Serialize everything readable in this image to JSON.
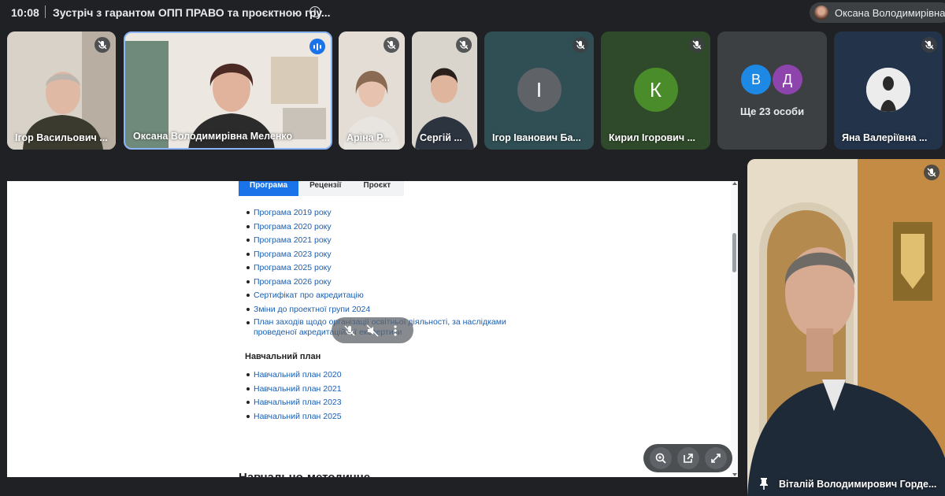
{
  "header": {
    "time": "10:08",
    "title": "Зустріч з гарантом ОПП ПРАВО та проєктною гру...",
    "info_icon": "info-icon",
    "presenter_name": "Оксана Володимирівна Ме"
  },
  "participants": [
    {
      "name": "Ігор Васильович ...",
      "status": "mic-off"
    },
    {
      "name": "Оксана Володимирівна Меленко",
      "status": "speaking"
    },
    {
      "name": "Аріна Р...",
      "status": "mic-off"
    },
    {
      "name": "Сергій ...",
      "status": "mic-off"
    },
    {
      "name": "Ігор Іванович Ба...",
      "status": "mic-off",
      "avatar_letter": "І",
      "avatar_color": "#5f6368"
    },
    {
      "name": "Кирил Ігорович ...",
      "status": "mic-off",
      "avatar_letter": "К",
      "avatar_color": "#4a8c2a"
    },
    {
      "name": "Яна Валеріївна ...",
      "status": "mic-off"
    }
  ],
  "others": {
    "letters": [
      "В",
      "Д"
    ],
    "colors": [
      "#1e88e5",
      "#8e44ad"
    ],
    "label": "Ще 23 особи"
  },
  "shared_screen": {
    "tabs": [
      "Програма",
      "Рецензії",
      "Проєкт"
    ],
    "active_tab": "Програма",
    "links": [
      "Програма 2019 року",
      "Програма 2020 року",
      "Програма 2021 року",
      "Програма 2023 року",
      "Програма 2025 року",
      "Програма 2026 року",
      "Сертифікат про акредитацію",
      "Зміни до проектної групи 2024",
      "План заходів щодо організації освітньої діяльності, за наслідками проведеної акредитаційної експертизи"
    ],
    "section_heading": "Навчальний план",
    "plan_links": [
      "Навчальний план 2020",
      "Навчальний план 2021",
      "Навчальний план 2023",
      "Навчальний план 2025"
    ],
    "cut_heading": "Навчально-методичне"
  },
  "speaker": {
    "name": "Віталій Володимирович Горде..."
  },
  "colors": {
    "background": "#202124",
    "accent": "#1a73e8",
    "link": "#1a5fb4"
  }
}
